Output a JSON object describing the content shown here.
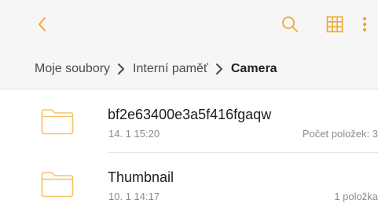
{
  "colors": {
    "accent": "#f0a830",
    "background": "#ffffff",
    "toolbar_background": "#f6f6f6",
    "folder_icon": "#f4c46a"
  },
  "toolbar": {
    "back_icon": "chevron-left-icon",
    "search_icon": "search-icon",
    "grid_icon": "grid-view-icon",
    "more_icon": "more-vertical-icon"
  },
  "breadcrumb": {
    "items": [
      "Moje soubory",
      "Interní paměť",
      "Camera"
    ]
  },
  "files": [
    {
      "name": "bf2e63400e3a5f416fgaqw",
      "date": "14. 1 15:20",
      "count": "Počet položek: 3"
    },
    {
      "name": "Thumbnail",
      "date": "10. 1 14:17",
      "count": "1 položka"
    }
  ]
}
